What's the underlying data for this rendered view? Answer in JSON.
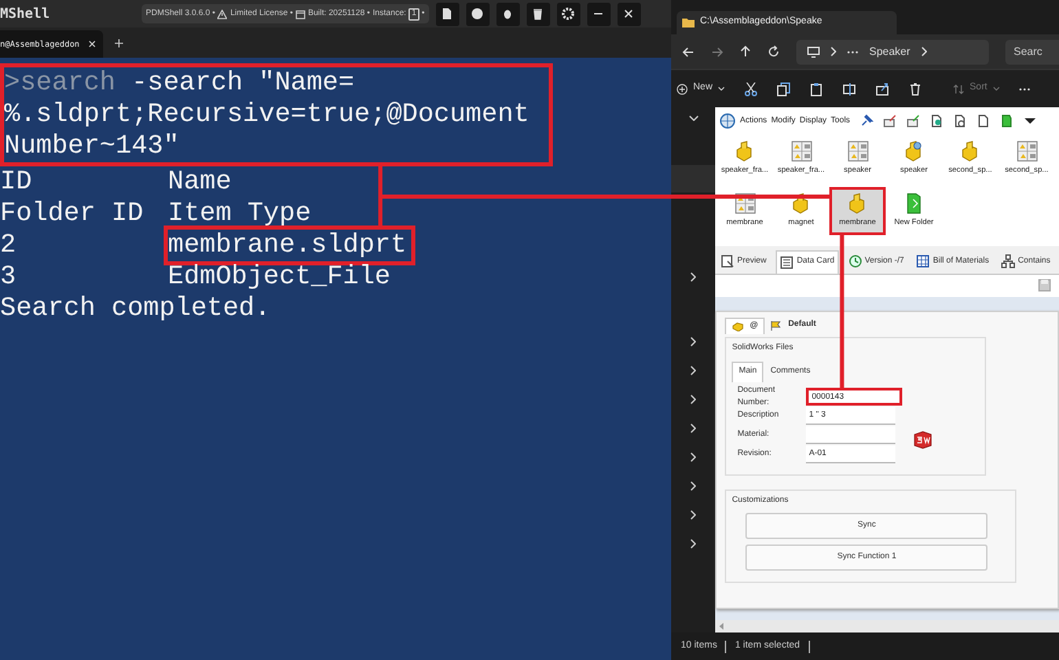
{
  "terminal": {
    "title": "MShell",
    "info": [
      {
        "kind": "text",
        "text": "PDMShell 3.0.6.0 •"
      },
      {
        "kind": "warning",
        "text": "Limited License •"
      },
      {
        "kind": "build",
        "text": "Built: 20251128 •"
      },
      {
        "kind": "text",
        "text": "Instance:"
      },
      {
        "kind": "badge",
        "text": "1"
      },
      {
        "kind": "text",
        "text": "•"
      }
    ],
    "tabs": [
      {
        "label": "n@Assemblageddon",
        "selected": true
      }
    ],
    "command": {
      "prompt": ">search",
      "lines": [
        " -search \"Name=",
        "%.sldprt;Recursive=true;@Document",
        "Number~143\""
      ],
      "highlighted": true
    },
    "output": [
      {
        "cells": [
          "ID",
          "Name"
        ],
        "highlighted": false
      },
      {
        "cells": [
          "Folder ID",
          "Item Type"
        ],
        "highlighted": false
      },
      {
        "cells": [
          "2",
          "membrane.sldprt"
        ],
        "highlighted": true
      },
      {
        "cells": [
          "3",
          "EdmObject_File"
        ],
        "highlighted": false
      }
    ],
    "message": "Search completed."
  },
  "explorer": {
    "tab_title": "C:\\Assemblageddon\\Speake",
    "breadcrumb": "Speaker",
    "search_placeholder": "Searc",
    "new_label": "New",
    "sort_label": "Sort",
    "pdm_menu": [
      "Actions",
      "Modify",
      "Display",
      "Tools"
    ],
    "files": [
      {
        "name": "speaker_fra...",
        "kind": "part",
        "selected": false
      },
      {
        "name": "speaker_fra...",
        "kind": "drawing",
        "selected": false
      },
      {
        "name": "speaker",
        "kind": "drawing",
        "selected": false
      },
      {
        "name": "speaker",
        "kind": "part-marked",
        "selected": false
      },
      {
        "name": "second_sp...",
        "kind": "part",
        "selected": false
      },
      {
        "name": "second_sp...",
        "kind": "drawing",
        "selected": false
      },
      {
        "name": "membrane",
        "kind": "drawing",
        "selected": false
      },
      {
        "name": "magnet",
        "kind": "part",
        "selected": false
      },
      {
        "name": "membrane",
        "kind": "part",
        "selected": true
      },
      {
        "name": "New Folder",
        "kind": "folder",
        "selected": false
      }
    ],
    "tabs": [
      {
        "label": "Preview",
        "selected": false
      },
      {
        "label": "Data Card",
        "selected": true
      },
      {
        "label": "Version -/7",
        "selected": false
      },
      {
        "label": "Bill of Materials",
        "selected": false
      },
      {
        "label": "Contains",
        "selected": false
      }
    ],
    "data_card": {
      "config": "@",
      "config_name": "Default",
      "group": "SolidWorks Files",
      "tabs": [
        {
          "label": "Main",
          "selected": true
        },
        {
          "label": "Comments",
          "selected": false
        }
      ],
      "fields": [
        {
          "label": "Document Number:",
          "value": "0000143",
          "highlighted": true
        },
        {
          "label": "Description",
          "value": "1 \" 3",
          "highlighted": false
        },
        {
          "label": "Material:",
          "highlighted": false
        },
        {
          "label": "Revision:",
          "value": "A-01",
          "highlighted": false
        }
      ],
      "customizations": {
        "title": "Customizations",
        "buttons": [
          "Sync",
          "Sync Function 1"
        ]
      }
    },
    "status_bar": [
      "10 items",
      "1 item selected"
    ]
  }
}
